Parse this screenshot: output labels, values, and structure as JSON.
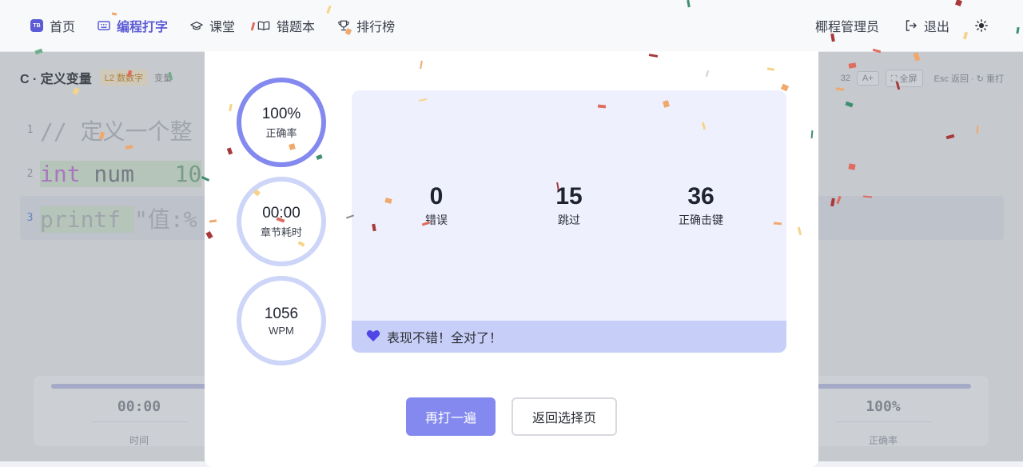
{
  "nav": {
    "brand_badge": "TB",
    "items": [
      {
        "label": "首页",
        "icon": "logo-icon"
      },
      {
        "label": "编程打字",
        "icon": "keyboard-icon",
        "active": true
      },
      {
        "label": "课堂",
        "icon": "graduation-cap-icon"
      },
      {
        "label": "错题本",
        "icon": "book-icon"
      },
      {
        "label": "排行榜",
        "icon": "trophy-icon"
      }
    ],
    "user": "椰程管理员",
    "logout": "退出",
    "theme_icon": "sun-icon"
  },
  "background": {
    "title": "C · 定义变量",
    "tag": "L2 数数字",
    "tag2": "变量",
    "tools": {
      "count": "32",
      "font_button": "A+",
      "fullscreen": "全屏",
      "hint": "Esc 返回 · ↻ 重打"
    },
    "code_lines": [
      {
        "num": "1",
        "text": "// 定义一个整"
      },
      {
        "num": "2",
        "text": "int num   10"
      },
      {
        "num": "3",
        "text": "printf \"值:%"
      }
    ],
    "stats": [
      {
        "value": "00:00",
        "label": "时间"
      },
      {
        "value": "100%",
        "label": "正确率"
      }
    ]
  },
  "result": {
    "rings": [
      {
        "value": "100%",
        "label": "正确率",
        "fraction": 1.0
      },
      {
        "value": "00:00",
        "label": "章节耗时"
      },
      {
        "value": "1056",
        "label": "WPM"
      }
    ],
    "stats": [
      {
        "value": "0",
        "label": "错误"
      },
      {
        "value": "15",
        "label": "跳过"
      },
      {
        "value": "36",
        "label": "正确击键"
      }
    ],
    "message": "表现不错！全对了！",
    "message_icon": "heart-icon",
    "retry_button": "再打一遍",
    "back_button": "返回选择页"
  },
  "colors": {
    "accent": "#8389ee",
    "accent_active": "#5b5bd6",
    "panel": "#eef1fd",
    "message_bar": "#c7cff8",
    "heart": "#4f46e5"
  }
}
